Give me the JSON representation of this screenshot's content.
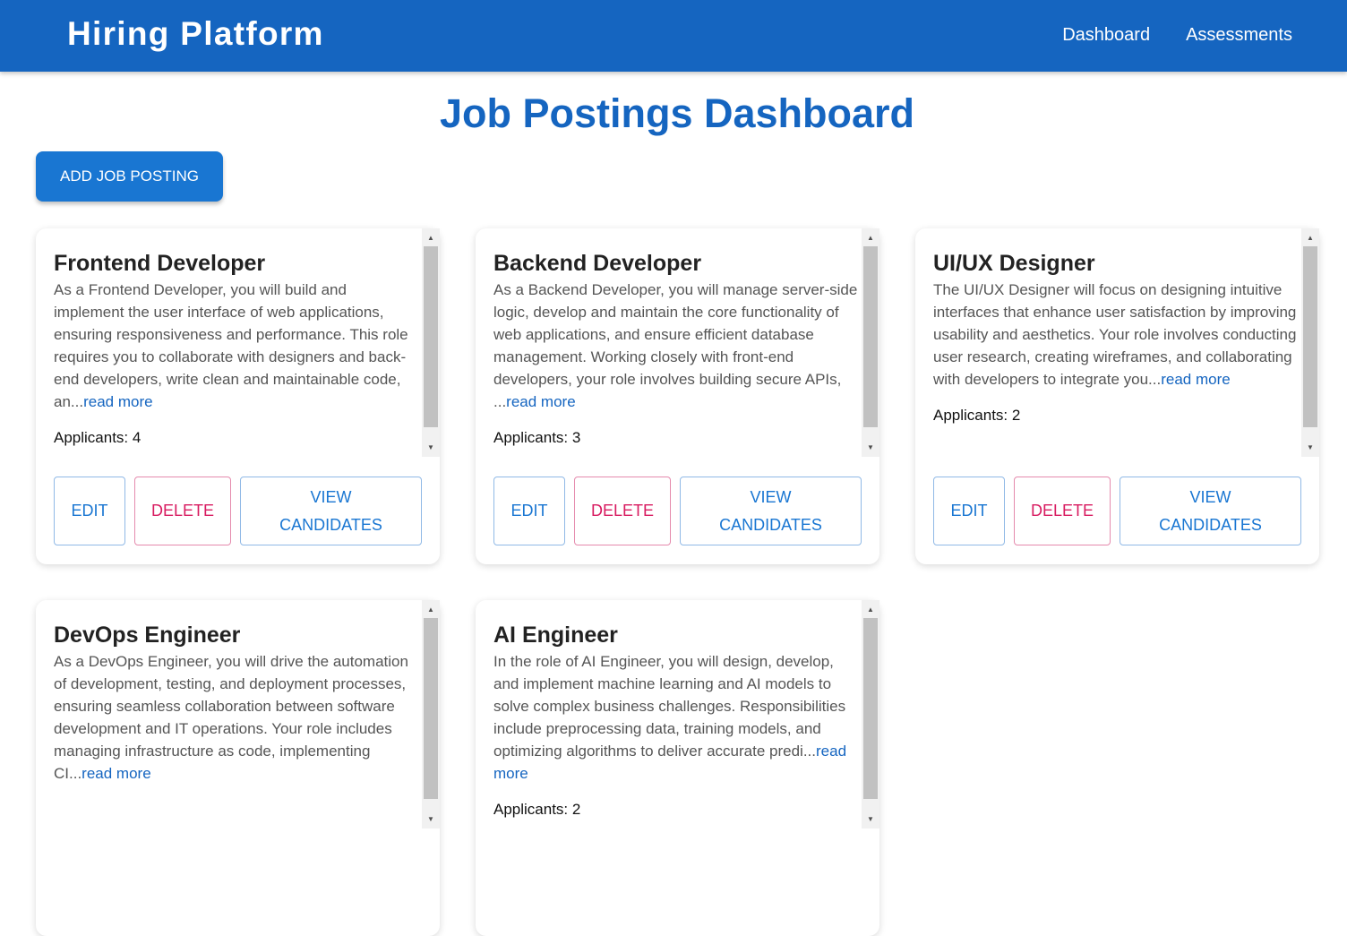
{
  "header": {
    "brand": "Hiring Platform",
    "nav": [
      "Dashboard",
      "Assessments"
    ]
  },
  "page": {
    "title": "Job Postings Dashboard",
    "add_button": "ADD JOB POSTING"
  },
  "jobs": [
    {
      "title": "Frontend Developer",
      "description": "As a Frontend Developer, you will build and implement the user interface of web applications, ensuring responsiveness and performance. This role requires you to collaborate with designers and back-end developers, write clean and maintainable code, an...",
      "read_more": "read more",
      "applicants": "Applicants: 4"
    },
    {
      "title": "Backend Developer",
      "description": "As a Backend Developer, you will manage server-side logic, develop and maintain the core functionality of web applications, and ensure efficient database management. Working closely with front-end developers, your role involves building secure APIs, ...",
      "read_more": "read more",
      "applicants": "Applicants: 3"
    },
    {
      "title": "UI/UX Designer",
      "description": "The UI/UX Designer will focus on designing intuitive interfaces that enhance user satisfaction by improving usability and aesthetics. Your role involves conducting user research, creating wireframes, and collaborating with developers to integrate you...",
      "read_more": "read more",
      "applicants": "Applicants: 2"
    },
    {
      "title": "DevOps Engineer",
      "description": "As a DevOps Engineer, you will drive the automation of development, testing, and deployment processes, ensuring seamless collaboration between software development and IT operations. Your role includes managing infrastructure as code, implementing CI...",
      "read_more": "read more",
      "applicants": ""
    },
    {
      "title": "AI Engineer",
      "description": "In the role of AI Engineer, you will design, develop, and implement machine learning and AI models to solve complex business challenges. Responsibilities include preprocessing data, training models, and optimizing algorithms to deliver accurate predi...",
      "read_more": "read more",
      "applicants": "Applicants: 2"
    }
  ],
  "card_actions": {
    "edit": "EDIT",
    "delete": "DELETE",
    "view_line1": "VIEW",
    "view_line2": "CANDIDATES"
  },
  "icons": {
    "scroll_up": "triangle-up-icon",
    "scroll_down": "triangle-down-icon"
  },
  "colors": {
    "primary": "#1565c0",
    "button": "#1976d2",
    "danger": "#d81b60"
  }
}
